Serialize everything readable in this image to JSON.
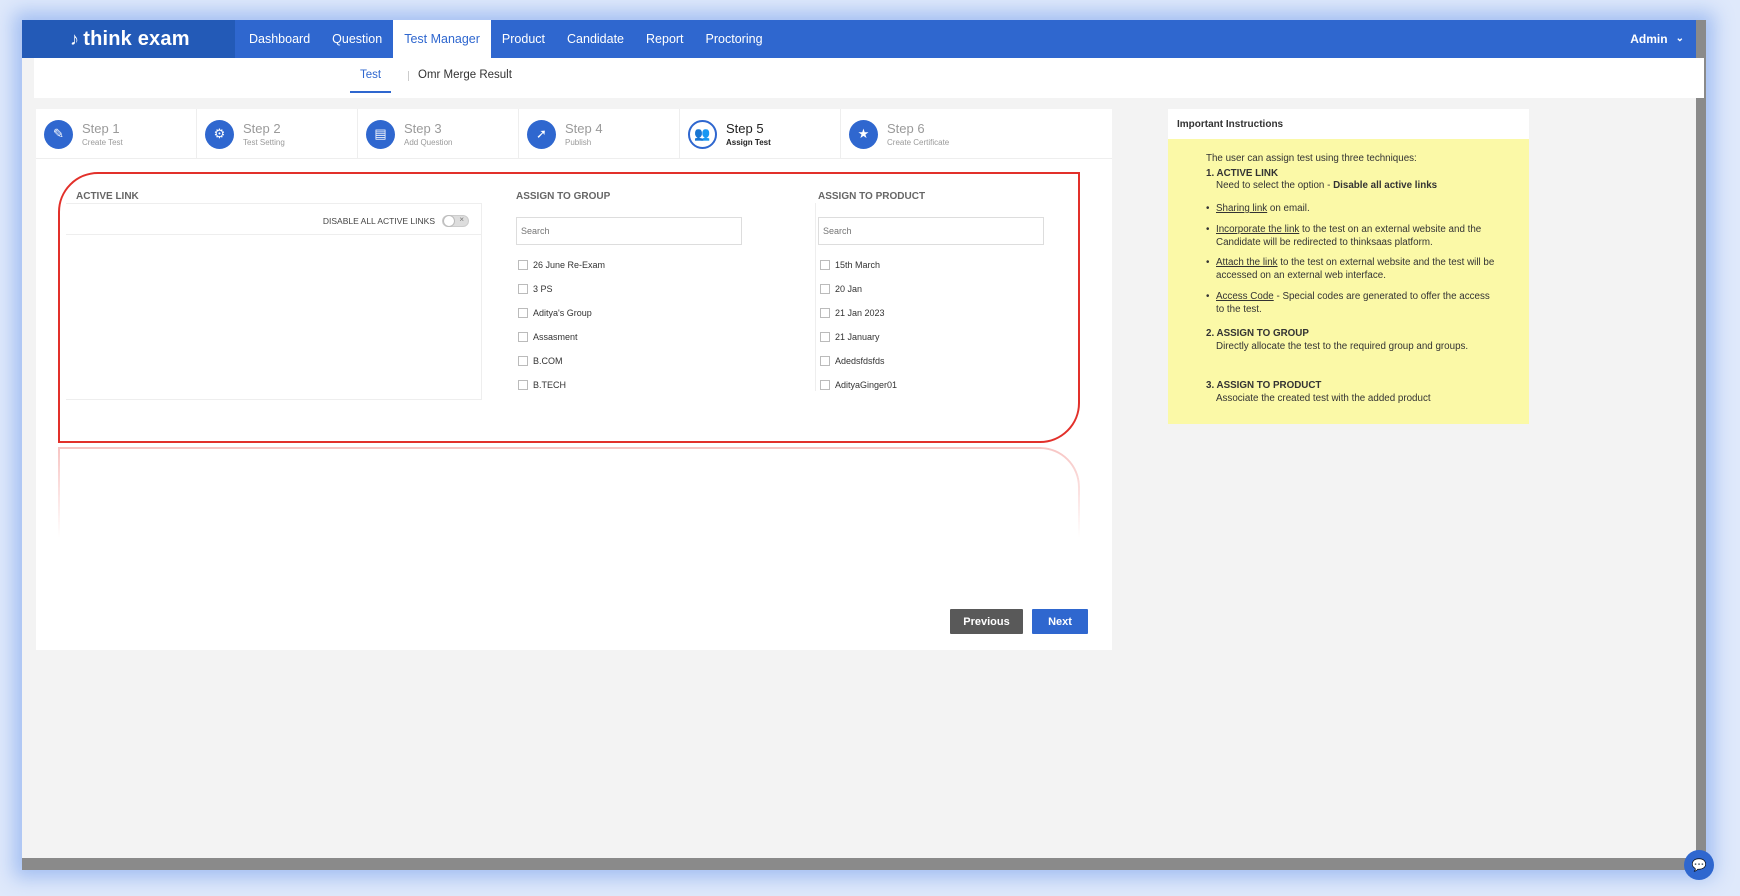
{
  "brand": {
    "logo_text": "think exam"
  },
  "nav": {
    "items": [
      {
        "label": "Dashboard"
      },
      {
        "label": "Question"
      },
      {
        "label": "Test Manager"
      },
      {
        "label": "Product"
      },
      {
        "label": "Candidate"
      },
      {
        "label": "Report"
      },
      {
        "label": "Proctoring"
      }
    ],
    "user": "Admin"
  },
  "subnav": {
    "tabs": [
      {
        "label": "Test"
      },
      {
        "label": "Omr Merge Result"
      }
    ]
  },
  "steps": [
    {
      "title": "Step 1",
      "sub": "Create Test",
      "icon": "pencil-icon"
    },
    {
      "title": "Step 2",
      "sub": "Test Setting",
      "icon": "gear-icon"
    },
    {
      "title": "Step 3",
      "sub": "Add Question",
      "icon": "document-icon"
    },
    {
      "title": "Step 4",
      "sub": "Publish",
      "icon": "rocket-icon"
    },
    {
      "title": "Step 5",
      "sub": "Assign Test",
      "icon": "users-icon"
    },
    {
      "title": "Step 6",
      "sub": "Create Certificate",
      "icon": "star-icon"
    }
  ],
  "active_link": {
    "title": "ACTIVE LINK",
    "disable_label": "DISABLE ALL ACTIVE LINKS"
  },
  "assign_group": {
    "title": "ASSIGN TO GROUP",
    "search_placeholder": "Search",
    "items": [
      "26 June Re-Exam",
      "3 PS",
      "Aditya's Group",
      "Assasment",
      "B.COM",
      "B.TECH"
    ]
  },
  "assign_product": {
    "title": "ASSIGN TO PRODUCT",
    "search_placeholder": "Search",
    "items": [
      "15th March",
      "20 Jan",
      "21 Jan 2023",
      "21 January",
      "Adedsfdsfds",
      "AdityaGinger01"
    ]
  },
  "buttons": {
    "previous": "Previous",
    "next": "Next"
  },
  "instructions": {
    "title": "Important Instructions",
    "intro": "The user can assign test using three techniques:",
    "s1_title": "1. ACTIVE LINK",
    "s1_text_pre": "Need to select the option - ",
    "s1_text_bold": "Disable all active links",
    "b1_link": "Sharing link",
    "b1_text": " on email.",
    "b2_link": "Incorporate the link",
    "b2_text": " to the test on an external website and the Candidate will be redirected to thinksaas platform.",
    "b3_link": "Attach the link",
    "b3_text": " to the test on external website and the test will be accessed on an external web interface.",
    "b4_link": "Access Code",
    "b4_text": " - Special codes are generated to offer the access to the test.",
    "s2_title": "2. ASSIGN TO GROUP",
    "s2_text": "Directly allocate the test to the required group and groups.",
    "s3_title": "3. ASSIGN TO PRODUCT",
    "s3_text": "Associate the created test with the added product"
  },
  "colors": {
    "primary": "#2f67cf",
    "highlight": "#e2302a",
    "instructions_bg": "#fbf9a7"
  }
}
